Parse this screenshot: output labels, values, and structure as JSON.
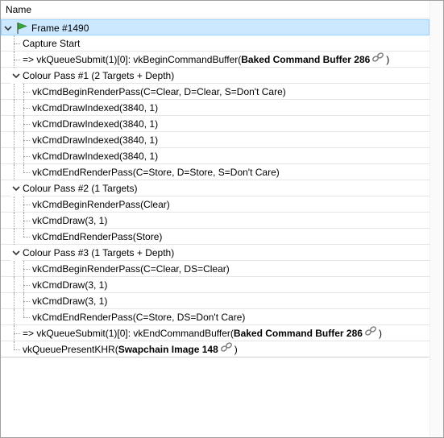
{
  "header": {
    "column_name": "Name"
  },
  "rows": [
    {
      "text": "Frame #1490"
    },
    {
      "text": "Capture Start"
    },
    {
      "prefix": "=> vkQueueSubmit(1)[0]: vkBeginCommandBuffer(",
      "bold": "Baked Command Buffer 286",
      "suffix": ")"
    },
    {
      "text": "Colour Pass #1 (2 Targets + Depth)"
    },
    {
      "text": "vkCmdBeginRenderPass(C=Clear, D=Clear, S=Don't Care)"
    },
    {
      "text": "vkCmdDrawIndexed(3840, 1)"
    },
    {
      "text": "vkCmdDrawIndexed(3840, 1)"
    },
    {
      "text": "vkCmdDrawIndexed(3840, 1)"
    },
    {
      "text": "vkCmdDrawIndexed(3840, 1)"
    },
    {
      "text": "vkCmdEndRenderPass(C=Store, D=Store, S=Don't Care)"
    },
    {
      "text": "Colour Pass #2 (1 Targets)"
    },
    {
      "text": "vkCmdBeginRenderPass(Clear)"
    },
    {
      "text": "vkCmdDraw(3, 1)"
    },
    {
      "text": "vkCmdEndRenderPass(Store)"
    },
    {
      "text": "Colour Pass #3 (1 Targets + Depth)"
    },
    {
      "text": "vkCmdBeginRenderPass(C=Clear, DS=Clear)"
    },
    {
      "text": "vkCmdDraw(3, 1)"
    },
    {
      "text": "vkCmdDraw(3, 1)"
    },
    {
      "text": "vkCmdEndRenderPass(C=Store, DS=Don't Care)"
    },
    {
      "prefix": "=> vkQueueSubmit(1)[0]: vkEndCommandBuffer(",
      "bold": "Baked Command Buffer 286",
      "suffix": ")"
    },
    {
      "prefix": "vkQueuePresentKHR(",
      "bold": "Swapchain Image 148",
      "suffix": ")"
    }
  ],
  "colors": {
    "selection": "#cce8ff",
    "flag": "#3aa33a"
  },
  "icons": {
    "expanded": "chevron-down-icon",
    "marker": "flag-icon",
    "resource": "link-icon"
  }
}
